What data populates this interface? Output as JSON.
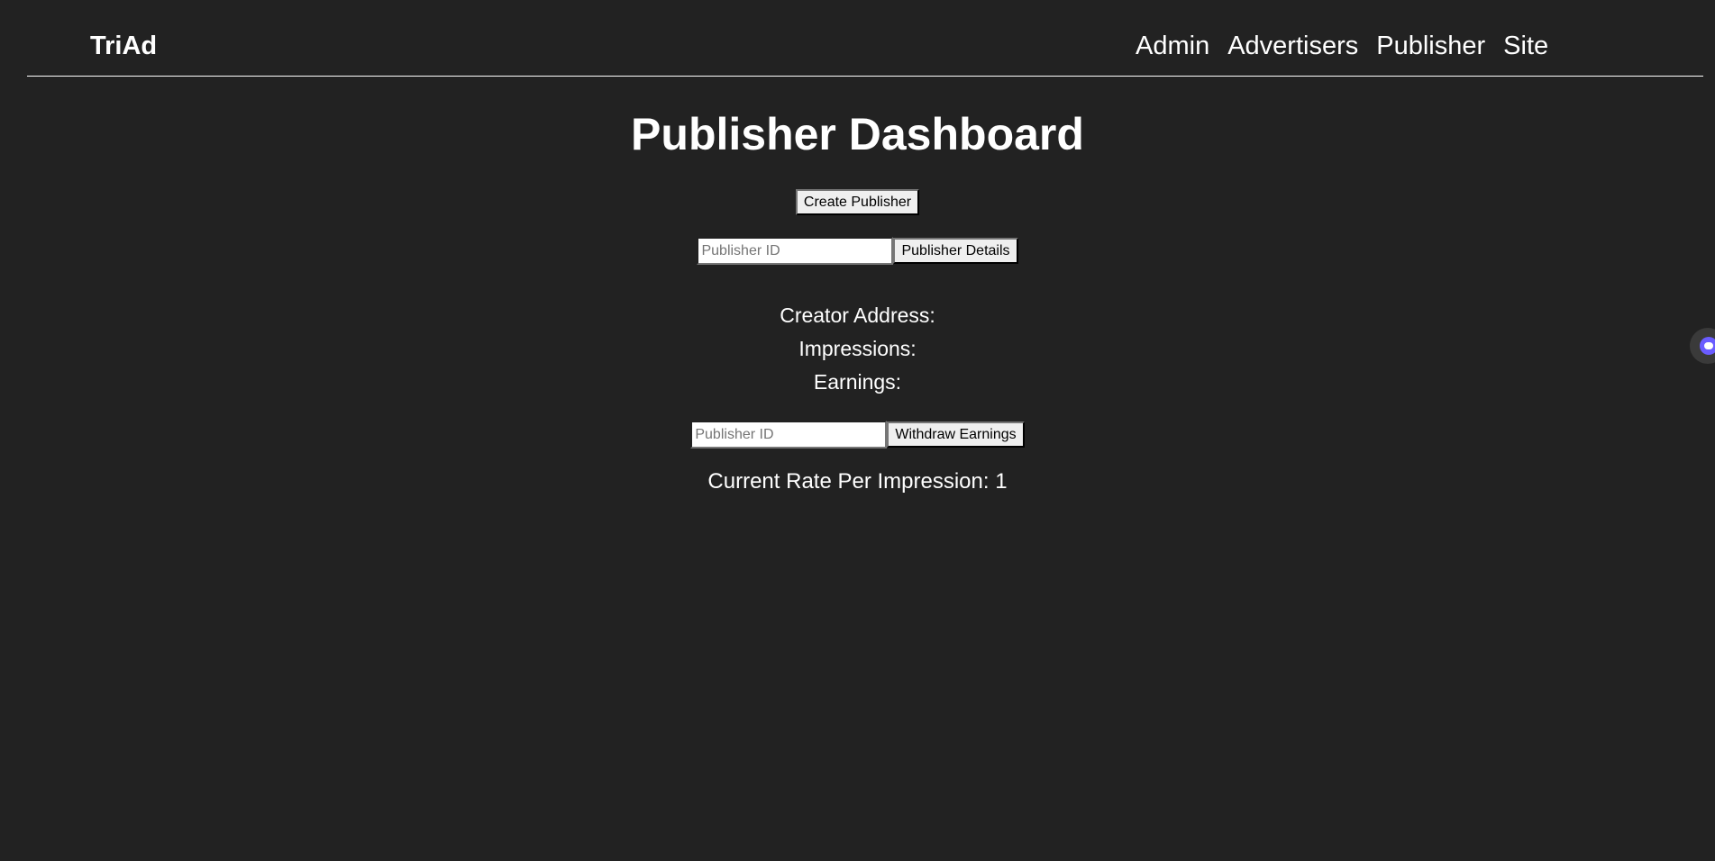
{
  "nav": {
    "brand": "TriAd",
    "links": [
      {
        "label": "Admin"
      },
      {
        "label": "Advertisers"
      },
      {
        "label": "Publisher"
      },
      {
        "label": "Site"
      }
    ]
  },
  "main": {
    "title": "Publisher Dashboard",
    "create_button": "Create Publisher",
    "details": {
      "input_placeholder": "Publisher ID",
      "input_value": "",
      "button": "Publisher Details"
    },
    "info": {
      "creator_address": "Creator Address:",
      "impressions": "Impressions:",
      "earnings": "Earnings:"
    },
    "withdraw": {
      "input_placeholder": "Publisher ID",
      "input_value": "",
      "button": "Withdraw Earnings"
    },
    "rate": "Current Rate Per Impression: 1"
  },
  "icons": {
    "side_widget": "assistant-widget-icon"
  },
  "colors": {
    "background": "#222222",
    "text": "#ffffff",
    "widget_accent": "#6a5cff"
  }
}
